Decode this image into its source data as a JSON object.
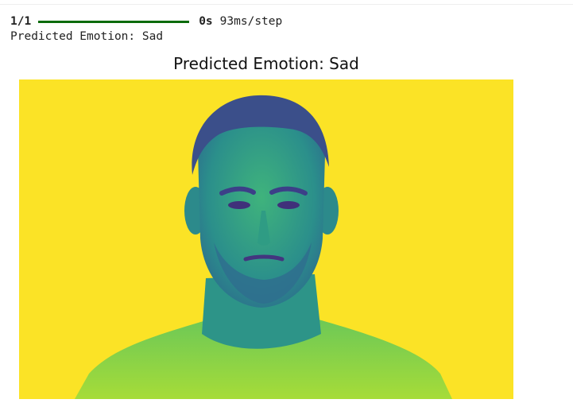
{
  "progress": {
    "step_label": "1/1",
    "fraction": 1.0,
    "elapsed": "0s",
    "per_step": "93ms/step"
  },
  "stdout": "Predicted Emotion: Sad",
  "plot": {
    "title": "Predicted Emotion: Sad",
    "colormap": "viridis",
    "background_color": "#fbe326",
    "image_subject": "face-photo"
  }
}
